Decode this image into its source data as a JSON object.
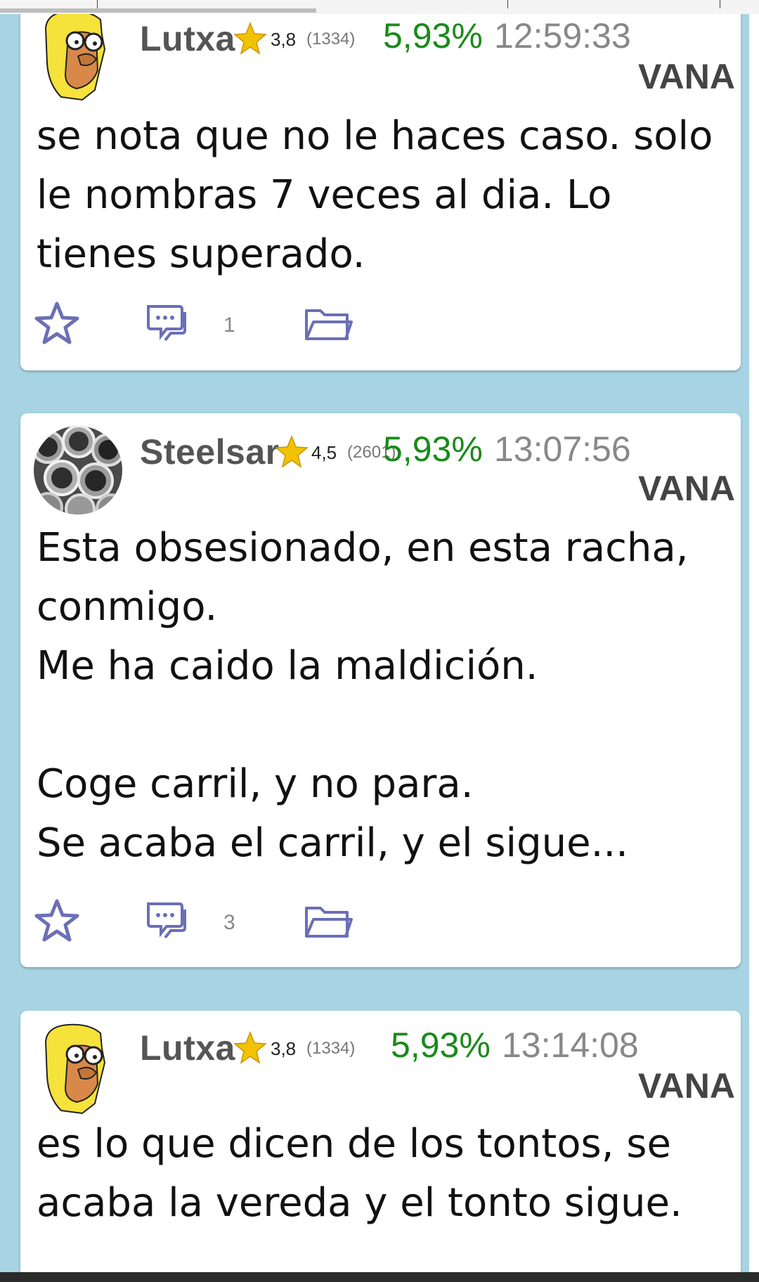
{
  "posts": [
    {
      "author": "Lutxa",
      "rating": "3,8",
      "rating_count": "(1334)",
      "percent": "5,93%",
      "time": "12:59:33",
      "ticker": "VANA",
      "body": "se nota que no le haces caso. solo\nle nombras 7 veces al dia. Lo\ntienes superado.",
      "comments": "1",
      "avatar": "homer-avatar"
    },
    {
      "author": "Steelsar",
      "rating": "4,5",
      "rating_count": "(2601)",
      "percent": "5,93%",
      "time": "13:07:56",
      "ticker": "VANA",
      "body": "Esta obsesionado, en esta racha,\nconmigo.\nMe ha caido la maldición.\n\nCoge carril, y no para.\nSe acaba el carril, y el sigue...",
      "comments": "3",
      "avatar": "steel-pipes-avatar"
    },
    {
      "author": "Lutxa",
      "rating": "3,8",
      "rating_count": "(1334)",
      "percent": "5,93%",
      "time": "13:14:08",
      "ticker": "VANA",
      "body": "es lo que dicen de los tontos, se\nacaba la vereda y el tonto sigue.",
      "avatar": "homer-avatar"
    }
  ],
  "icons": {
    "favorite": "star-outline-icon",
    "comments": "speech-bubble-icon",
    "folder": "folder-icon",
    "rating": "gold-star-icon"
  },
  "colors": {
    "background": "#a7d3e2",
    "percent": "#1a8a1a",
    "icon": "#6b6fb5",
    "star": "#f2c200"
  }
}
